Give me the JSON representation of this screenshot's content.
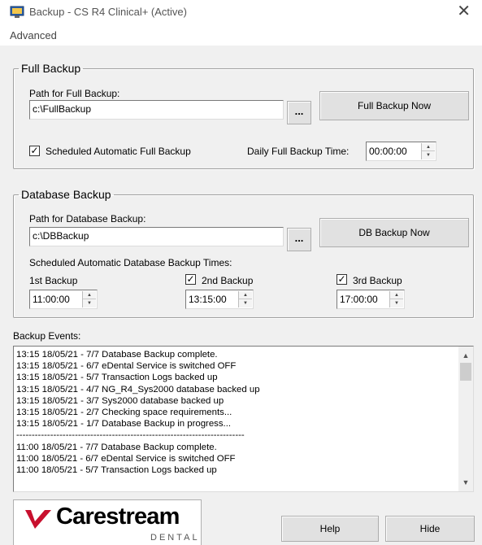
{
  "window": {
    "title": "Backup - CS R4 Clinical+ (Active)",
    "close_glyph": "✕"
  },
  "menu": {
    "advanced": "Advanced"
  },
  "full_backup": {
    "legend": "Full Backup",
    "path_label": "Path for Full Backup:",
    "path_value": "c:\\FullBackup",
    "browse_label": "...",
    "backup_now": "Full Backup Now",
    "scheduled_label": "Scheduled Automatic Full Backup",
    "scheduled_checked": true,
    "daily_time_label": "Daily Full Backup Time:",
    "daily_time_value": "00:00:00"
  },
  "db_backup": {
    "legend": "Database Backup",
    "path_label": "Path for Database Backup:",
    "path_value": "c:\\DBBackup",
    "browse_label": "...",
    "backup_now": "DB Backup Now",
    "scheduled_times_label": "Scheduled Automatic Database Backup Times:",
    "first": {
      "label": "1st Backup",
      "time": "11:00:00"
    },
    "second": {
      "label": "2nd Backup",
      "checked": true,
      "time": "13:15:00"
    },
    "third": {
      "label": "3rd Backup",
      "checked": true,
      "time": "17:00:00"
    }
  },
  "events": {
    "label": "Backup Events:",
    "lines": [
      "13:15 18/05/21 - 7/7 Database Backup complete.",
      "13:15 18/05/21 - 6/7 eDental Service is switched OFF",
      "13:15 18/05/21 - 5/7 Transaction Logs backed up",
      "13:15 18/05/21 - 4/7 NG_R4_Sys2000 database backed up",
      "13:15 18/05/21 - 3/7 Sys2000 database backed up",
      "13:15 18/05/21 - 2/7 Checking space requirements...",
      "13:15 18/05/21 - 1/7 Database Backup in progress...",
      "--------------------------------------------------------------------------",
      "11:00 18/05/21 - 7/7 Database Backup complete.",
      "11:00 18/05/21 - 6/7 eDental Service is switched OFF",
      "11:00 18/05/21 - 5/7 Transaction Logs backed up"
    ]
  },
  "logo": {
    "name": "Carestream",
    "sub": "DENTAL"
  },
  "buttons": {
    "help": "Help",
    "hide": "Hide"
  },
  "colors": {
    "logo_red": "#c8102e",
    "window_bg": "#f0f0f0"
  }
}
